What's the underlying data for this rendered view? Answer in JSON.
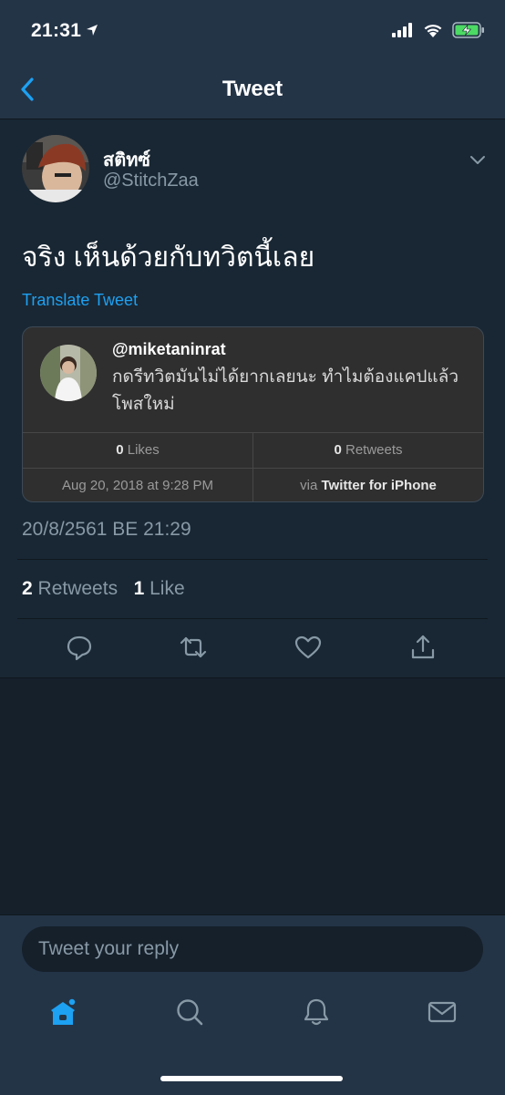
{
  "status_bar": {
    "time": "21:31",
    "icons": [
      "location-arrow-icon",
      "cellular-signal-icon",
      "wifi-icon",
      "battery-charging-icon"
    ]
  },
  "nav": {
    "title": "Tweet",
    "back_icon": "chevron-left-icon"
  },
  "tweet": {
    "display_name": "สติทซ์",
    "handle": "@StitchZaa",
    "text": "จริง เห็นด้วยกับทวิตนี้เลย",
    "translate_label": "Translate Tweet",
    "timestamp": "20/8/2561 BE 21:29",
    "retweet_count": "2",
    "retweet_label": "Retweets",
    "like_count": "1",
    "like_label": "Like"
  },
  "quoted": {
    "handle": "@miketaninrat",
    "text": "กดรีทวิตมันไม่ได้ยากเลยนะ ทำไมต้องแคปแล้วโพสใหม่",
    "likes_count": "0",
    "likes_label": "Likes",
    "retweets_count": "0",
    "retweets_label": "Retweets",
    "date": "Aug 20, 2018 at 9:28 PM",
    "via_prefix": "via",
    "via_client": "Twitter for iPhone"
  },
  "actions": [
    "reply-icon",
    "retweet-icon",
    "like-icon",
    "share-icon"
  ],
  "reply": {
    "placeholder": "Tweet your reply"
  },
  "tabs": [
    "home-icon",
    "search-icon",
    "notifications-icon",
    "messages-icon"
  ],
  "colors": {
    "background": "#15202b",
    "surface": "#192734",
    "bar": "#243447",
    "accent": "#1da1f2",
    "secondary_text": "#8899a6"
  }
}
